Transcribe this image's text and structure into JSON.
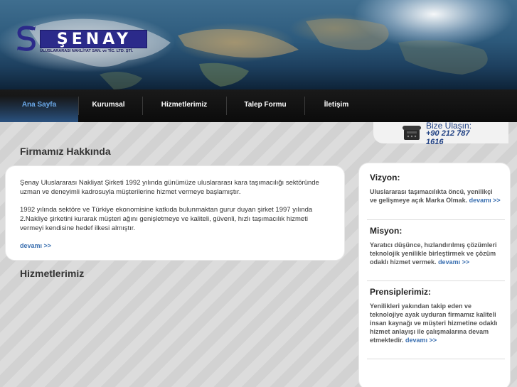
{
  "logo": {
    "wordmark": "ŞENAY",
    "tagline": "ULUSLARARASI NAKLİYAT SAN. ve TİC. LTD. ŞTİ."
  },
  "nav": {
    "items": [
      {
        "label": "Ana Sayfa",
        "active": true
      },
      {
        "label": "Kurumsal",
        "active": false
      },
      {
        "label": "Hizmetlerimiz",
        "active": false
      },
      {
        "label": "Talep Formu",
        "active": false
      },
      {
        "label": "İletişim",
        "active": false
      }
    ]
  },
  "contact": {
    "label": "Bize Ulaşın:",
    "phone": "+90 212 787 1616"
  },
  "about": {
    "title": "Firmamız Hakkında",
    "paragraph1": "Şenay Uluslararası Nakliyat Şirketi 1992 yılında günümüze uluslararası kara taşımacılığı sektöründe uzman ve deneyimli kadrosuyla müşterilerine hizmet vermeye başlamıştır.",
    "paragraph2": "1992 yılında sektöre ve Türkiye ekonomisine katkıda bulunmaktan gurur duyan şirket 1997 yılında 2.Nakliye şirketini kurarak müşteri ağını genişletmeye ve kaliteli, güvenli, hızlı taşımacılık hizmeti vermeyi kendisine hedef ilkesi almıştır.",
    "more": "devamı >>"
  },
  "services": {
    "title": "Hizmetlerimiz"
  },
  "side": {
    "vision": {
      "title": "Vizyon:",
      "text": "Uluslararası taşımacılıkta öncü, yenilikçi ve gelişmeye açık Marka Olmak.",
      "more": "devamı >>"
    },
    "mission": {
      "title": "Misyon:",
      "text": "Yaratıcı düşünce, hızlandırılmış çözümleri teknolojik yenilikle birleştirmek ve çözüm odaklı hizmet vermek.",
      "more": "devamı >>"
    },
    "principles": {
      "title": "Prensiplerimiz:",
      "text": "Yenilikleri yakından takip eden ve teknolojiye ayak uyduran firmamız kaliteli insan kaynağı ve müşteri hizmetine odaklı hizmet anlayışı ile çalışmalarına devam etmektedir.",
      "more": "devamı >>"
    }
  },
  "colors": {
    "brand_navy": "#2b2a8a",
    "nav_active": "#6aa8e8",
    "link": "#3a6fb0"
  }
}
